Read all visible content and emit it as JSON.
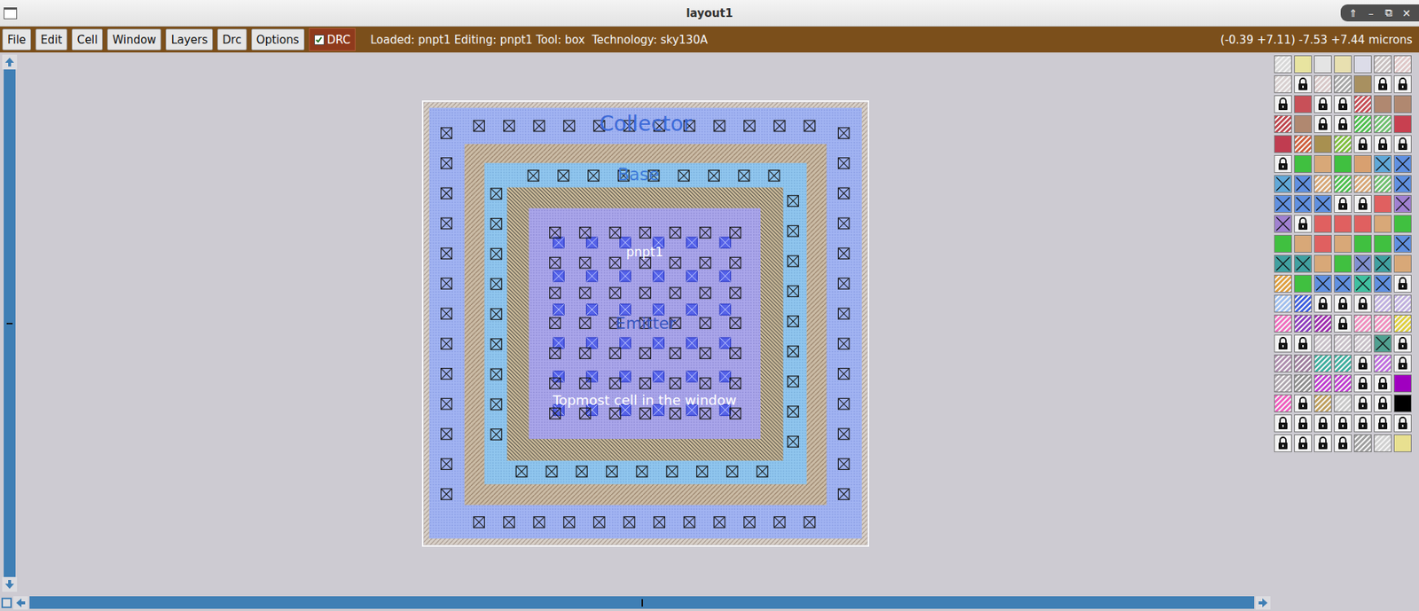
{
  "window": {
    "title": "layout1",
    "controls": [
      "⇑",
      "–",
      "⧉",
      "✕"
    ]
  },
  "menus": [
    "File",
    "Edit",
    "Cell",
    "Window",
    "Layers",
    "Drc",
    "Options"
  ],
  "drc_toggle": {
    "label": "DRC",
    "checked": true
  },
  "status": "Loaded: pnpt1 Editing: pnpt1 Tool: box  Technology: sky130A",
  "coordinates": "(-0.39 +7.11) -7.53 +7.44 microns",
  "labels": {
    "collector": "Collector",
    "base": "Base",
    "emitter": "Emitter",
    "cell": "pnpt1",
    "window": "Topmost cell in the window"
  },
  "palette": [
    [
      {
        "kind": "hatch",
        "color": "#d8d8d8"
      },
      {
        "kind": "fill",
        "color": "#e8e4a0"
      },
      {
        "kind": "fill",
        "color": "#e4e4e4"
      },
      {
        "kind": "fill",
        "color": "#e8e0b0"
      },
      {
        "kind": "fill",
        "color": "#dcdce8"
      },
      {
        "kind": "hatch",
        "color": "#c8c0c0"
      },
      {
        "kind": "hatch",
        "color": "#e0c8c8"
      }
    ],
    [
      {
        "kind": "hatch",
        "color": "#d8d0d0"
      },
      {
        "kind": "lock",
        "color": "#f4f4f4"
      },
      {
        "kind": "hatch",
        "color": "#d8c8c8"
      },
      {
        "kind": "hatch",
        "color": "#a8a8a8"
      },
      {
        "kind": "fill",
        "color": "#a89060"
      },
      {
        "kind": "lock",
        "color": "#f4f4f4"
      },
      {
        "kind": "lock",
        "color": "#f4f4f4"
      }
    ],
    [
      {
        "kind": "lock",
        "color": "#f4f4f4"
      },
      {
        "kind": "fill",
        "color": "#c85058"
      },
      {
        "kind": "lock",
        "color": "#f4f4f4"
      },
      {
        "kind": "lock",
        "color": "#f4f4f4"
      },
      {
        "kind": "hatch",
        "color": "#c85058"
      },
      {
        "kind": "fill",
        "color": "#b08870"
      },
      {
        "kind": "fill",
        "color": "#b08870"
      }
    ],
    [
      {
        "kind": "hatch",
        "color": "#c04850"
      },
      {
        "kind": "fill",
        "color": "#b08870"
      },
      {
        "kind": "lock",
        "color": "#f4f4f4"
      },
      {
        "kind": "lock",
        "color": "#f4f4f4"
      },
      {
        "kind": "hatch",
        "color": "#50c050"
      },
      {
        "kind": "hatch",
        "color": "#70c070"
      },
      {
        "kind": "fill",
        "color": "#c84050"
      }
    ],
    [
      {
        "kind": "fill",
        "color": "#c03c50"
      },
      {
        "kind": "hatch",
        "color": "#d06040"
      },
      {
        "kind": "fill",
        "color": "#a89050"
      },
      {
        "kind": "hatch",
        "color": "#80c040"
      },
      {
        "kind": "lock",
        "color": "#f4f4f4"
      },
      {
        "kind": "lock",
        "color": "#f4f4f4"
      },
      {
        "kind": "lock",
        "color": "#f4f4f4"
      }
    ],
    [
      {
        "kind": "lock",
        "color": "#f4f4f4"
      },
      {
        "kind": "fill",
        "color": "#40c040"
      },
      {
        "kind": "fill",
        "color": "#d8a878"
      },
      {
        "kind": "fill",
        "color": "#40c040"
      },
      {
        "kind": "fill",
        "color": "#d8a070"
      },
      {
        "kind": "contact",
        "color": "#60a8d8"
      },
      {
        "kind": "contact",
        "color": "#6090e0"
      }
    ],
    [
      {
        "kind": "contact",
        "color": "#60a8d8"
      },
      {
        "kind": "contact",
        "color": "#6090e0"
      },
      {
        "kind": "hatch",
        "color": "#d8a878"
      },
      {
        "kind": "hatch",
        "color": "#50c050"
      },
      {
        "kind": "hatch",
        "color": "#d8a878"
      },
      {
        "kind": "hatch",
        "color": "#70c070"
      },
      {
        "kind": "contact",
        "color": "#6090e0"
      }
    ],
    [
      {
        "kind": "contact",
        "color": "#6090e0"
      },
      {
        "kind": "contact",
        "color": "#6090e0"
      },
      {
        "kind": "contact",
        "color": "#6090e0"
      },
      {
        "kind": "lock",
        "color": "#f4f4f4"
      },
      {
        "kind": "lock",
        "color": "#f4f4f4"
      },
      {
        "kind": "fill",
        "color": "#e06060"
      },
      {
        "kind": "contact",
        "color": "#a080d0"
      }
    ],
    [
      {
        "kind": "contact",
        "color": "#a080d0"
      },
      {
        "kind": "lock",
        "color": "#f4f4f4"
      },
      {
        "kind": "fill",
        "color": "#e06060"
      },
      {
        "kind": "fill",
        "color": "#e06060"
      },
      {
        "kind": "fill",
        "color": "#e06060"
      },
      {
        "kind": "fill",
        "color": "#d8a878"
      },
      {
        "kind": "fill",
        "color": "#40c040"
      }
    ],
    [
      {
        "kind": "fill",
        "color": "#40c040"
      },
      {
        "kind": "fill",
        "color": "#d8a878"
      },
      {
        "kind": "fill",
        "color": "#e06060"
      },
      {
        "kind": "fill",
        "color": "#d8a878"
      },
      {
        "kind": "fill",
        "color": "#40c040"
      },
      {
        "kind": "fill",
        "color": "#40c040"
      },
      {
        "kind": "contact",
        "color": "#6090e0"
      }
    ],
    [
      {
        "kind": "contact",
        "color": "#40a0a0"
      },
      {
        "kind": "contact",
        "color": "#40a0a0"
      },
      {
        "kind": "fill",
        "color": "#d8a878"
      },
      {
        "kind": "fill",
        "color": "#40c040"
      },
      {
        "kind": "contact",
        "color": "#8090d0"
      },
      {
        "kind": "contact",
        "color": "#40a0a0"
      },
      {
        "kind": "fill",
        "color": "#d8a878"
      }
    ],
    [
      {
        "kind": "hatch",
        "color": "#e0a040"
      },
      {
        "kind": "fill",
        "color": "#40c040"
      },
      {
        "kind": "contact",
        "color": "#6090e0"
      },
      {
        "kind": "contact",
        "color": "#6090e0"
      },
      {
        "kind": "contact",
        "color": "#40c0a0"
      },
      {
        "kind": "contact",
        "color": "#6090e0"
      },
      {
        "kind": "lock",
        "color": "#f4f4f4"
      }
    ],
    [
      {
        "kind": "hatch",
        "color": "#a0c0f0"
      },
      {
        "kind": "hatch",
        "color": "#4060e0"
      },
      {
        "kind": "lock",
        "color": "#f4f4f4"
      },
      {
        "kind": "lock",
        "color": "#f4f4f4"
      },
      {
        "kind": "lock",
        "color": "#f4f4f4"
      },
      {
        "kind": "hatch",
        "color": "#c0b0e0"
      },
      {
        "kind": "hatch",
        "color": "#c0b0e0"
      }
    ],
    [
      {
        "kind": "hatch",
        "color": "#f070c0"
      },
      {
        "kind": "hatch",
        "color": "#9040c0"
      },
      {
        "kind": "hatch",
        "color": "#a030b0"
      },
      {
        "kind": "lock",
        "color": "#f4f4f4"
      },
      {
        "kind": "hatch",
        "color": "#f090c0"
      },
      {
        "kind": "hatch",
        "color": "#f090c0"
      },
      {
        "kind": "hatch",
        "color": "#e0d040"
      }
    ],
    [
      {
        "kind": "lock",
        "color": "#f4f4f4"
      },
      {
        "kind": "lock",
        "color": "#f4f4f4"
      },
      {
        "kind": "hatch",
        "color": "#c8c0c8"
      },
      {
        "kind": "hatch",
        "color": "#c8c0c8"
      },
      {
        "kind": "hatch",
        "color": "#c8c0c8"
      },
      {
        "kind": "contact",
        "color": "#50a090"
      },
      {
        "kind": "lock",
        "color": "#f4f4f4"
      }
    ],
    [
      {
        "kind": "hatch",
        "color": "#b090b0"
      },
      {
        "kind": "hatch",
        "color": "#a080a0"
      },
      {
        "kind": "hatch",
        "color": "#40b0a0"
      },
      {
        "kind": "hatch",
        "color": "#40b0a0"
      },
      {
        "kind": "lock",
        "color": "#f4f4f4"
      },
      {
        "kind": "hatch",
        "color": "#c070e0"
      },
      {
        "kind": "lock",
        "color": "#f4f4f4"
      }
    ],
    [
      {
        "kind": "hatch",
        "color": "#b0a8b0"
      },
      {
        "kind": "hatch",
        "color": "#909090"
      },
      {
        "kind": "hatch",
        "color": "#c040d0"
      },
      {
        "kind": "hatch",
        "color": "#c040d0"
      },
      {
        "kind": "lock",
        "color": "#f4f4f4"
      },
      {
        "kind": "lock",
        "color": "#f4f4f4"
      },
      {
        "kind": "fill",
        "color": "#a000c0"
      }
    ],
    [
      {
        "kind": "hatch",
        "color": "#f060c0"
      },
      {
        "kind": "lock",
        "color": "#f4f4f4"
      },
      {
        "kind": "hatch",
        "color": "#c0a060"
      },
      {
        "kind": "hatch",
        "color": "#c8c8c8"
      },
      {
        "kind": "lock",
        "color": "#f4f4f4"
      },
      {
        "kind": "lock",
        "color": "#f4f4f4"
      },
      {
        "kind": "fill",
        "color": "#000000"
      }
    ],
    [
      {
        "kind": "lock",
        "color": "#f4f4f4"
      },
      {
        "kind": "lock",
        "color": "#f4f4f4"
      },
      {
        "kind": "lock",
        "color": "#f4f4f4"
      },
      {
        "kind": "lock",
        "color": "#f4f4f4"
      },
      {
        "kind": "lock",
        "color": "#f4f4f4"
      },
      {
        "kind": "lock",
        "color": "#f4f4f4"
      },
      {
        "kind": "lock",
        "color": "#f4f4f4"
      }
    ],
    [
      {
        "kind": "lock",
        "color": "#f4f4f4"
      },
      {
        "kind": "lock",
        "color": "#f4f4f4"
      },
      {
        "kind": "lock",
        "color": "#f4f4f4"
      },
      {
        "kind": "lock",
        "color": "#f4f4f4"
      },
      {
        "kind": "hatch",
        "color": "#a0a0a0"
      },
      {
        "kind": "hatch",
        "color": "#d0d0d0"
      },
      {
        "kind": "fill",
        "color": "#e8e090"
      }
    ]
  ]
}
